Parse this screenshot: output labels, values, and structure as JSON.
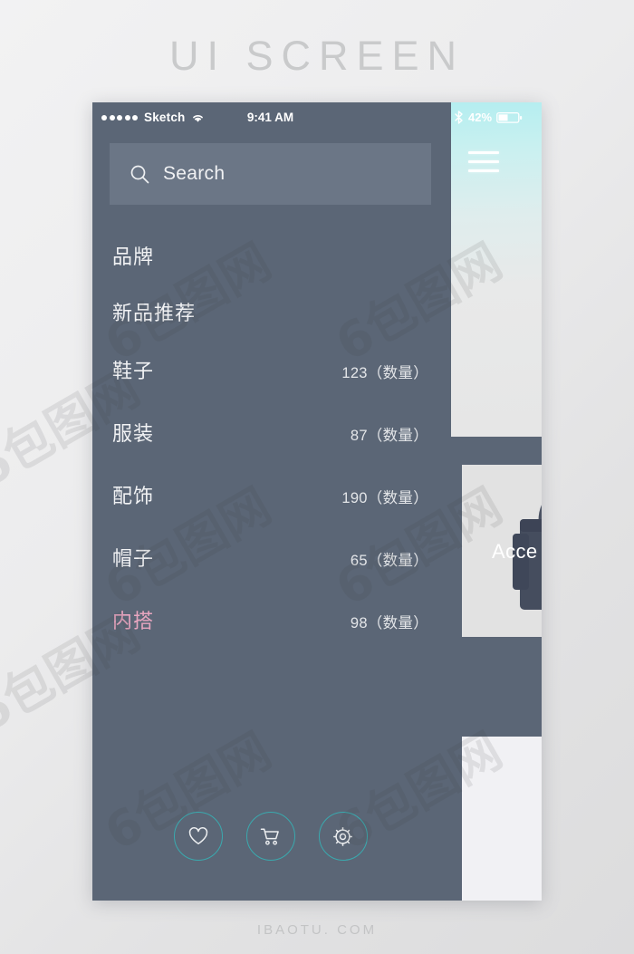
{
  "page": {
    "title": "UI SCREEN",
    "footer": "IBAOTU. COM"
  },
  "colors": {
    "sidebar_bg": "#5b6676",
    "search_bg": "#6b7686",
    "accent_teal": "#3aa9ae",
    "accent_pink": "#e8a6c0",
    "hero_gradient_start": "#b4eef0",
    "hero_gradient_end": "#e6e6e6",
    "text_light": "#f1f2f4"
  },
  "statusbar": {
    "carrier": "Sketch",
    "signal_dots": 5,
    "wifi_icon": "wifi-icon",
    "time": "9:41 AM",
    "bluetooth_icon": "bluetooth-icon",
    "battery_percent": "42%",
    "battery_level": 42
  },
  "search": {
    "icon": "search-icon",
    "placeholder": "Search",
    "value": ""
  },
  "menu": {
    "items": [
      {
        "label": "品牌",
        "count": ""
      },
      {
        "label": "新品推荐",
        "count": ""
      },
      {
        "label": "鞋子",
        "count": "123（数量）"
      },
      {
        "label": "服装",
        "count": "87（数量）"
      },
      {
        "label": "配饰",
        "count": "190（数量）"
      },
      {
        "label": "帽子",
        "count": "65（数量）"
      },
      {
        "label": "内搭",
        "count": "98（数量）"
      }
    ],
    "active_index": 6
  },
  "actions": [
    {
      "name": "favorites-button",
      "icon": "heart-icon"
    },
    {
      "name": "cart-button",
      "icon": "cart-icon"
    },
    {
      "name": "settings-button",
      "icon": "gear-icon"
    }
  ],
  "right_panel": {
    "menu_icon": "hamburger-icon",
    "card_label": "Acce",
    "card_image": "bag-image"
  },
  "watermark": {
    "text": "6包图网"
  }
}
